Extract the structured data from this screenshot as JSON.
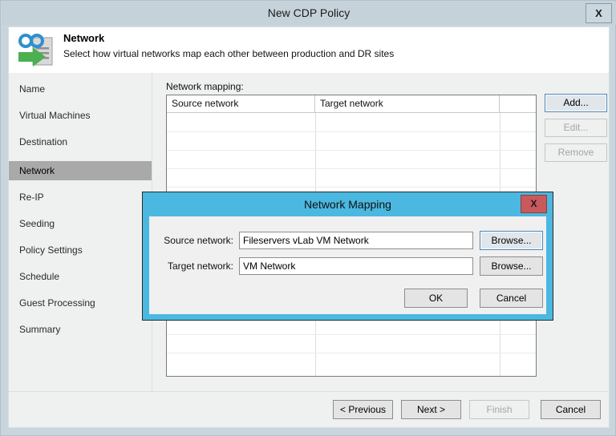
{
  "window": {
    "title": "New CDP Policy",
    "close_label": "X"
  },
  "header": {
    "icon": "network-policy-icon",
    "title": "Network",
    "subtitle": "Select how virtual networks map each other between production and DR sites"
  },
  "sidebar": {
    "items": [
      {
        "label": "Name",
        "selected": false
      },
      {
        "label": "Virtual Machines",
        "selected": false
      },
      {
        "label": "Destination",
        "selected": false
      },
      {
        "label": "Network",
        "selected": true
      },
      {
        "label": "Re-IP",
        "selected": false
      },
      {
        "label": "Seeding",
        "selected": false
      },
      {
        "label": "Policy Settings",
        "selected": false
      },
      {
        "label": "Schedule",
        "selected": false
      },
      {
        "label": "Guest Processing",
        "selected": false
      },
      {
        "label": "Summary",
        "selected": false
      }
    ]
  },
  "content": {
    "mapping_label": "Network mapping:",
    "table": {
      "columns": [
        "Source network",
        "Target network",
        ""
      ],
      "rows": []
    },
    "actions": {
      "add": "Add...",
      "edit": "Edit...",
      "remove": "Remove"
    }
  },
  "footer": {
    "previous": "< Previous",
    "next": "Next >",
    "finish": "Finish",
    "cancel": "Cancel"
  },
  "modal": {
    "title": "Network Mapping",
    "close_label": "X",
    "source_label": "Source network:",
    "source_value": "Fileservers vLab VM Network",
    "target_label": "Target network:",
    "target_value": "VM Network",
    "browse_1": "Browse...",
    "browse_2": "Browse...",
    "ok": "OK",
    "cancel": "Cancel"
  },
  "colors": {
    "titlebar": "#c6d2da",
    "modal_border": "#4ab8e0",
    "modal_close": "#c9595a",
    "selection": "#a9a9a9",
    "panel": "#eff0f0",
    "accent_focus": "#4a87b8"
  }
}
